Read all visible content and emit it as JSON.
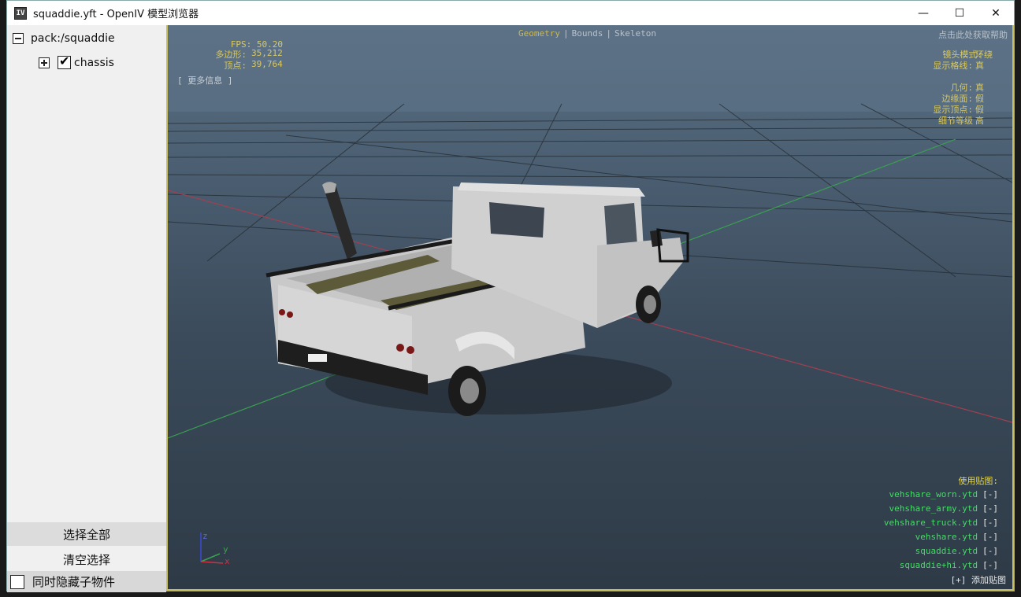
{
  "window": {
    "title": "squaddie.yft - OpenIV 模型浏览器",
    "app_icon_text": "IV",
    "min_glyph": "—",
    "max_glyph": "☐",
    "close_glyph": "✕"
  },
  "tree": {
    "root_label": "pack:/squaddie",
    "child_label": "chassis",
    "check_glyph": "✔"
  },
  "sidebar": {
    "select_all": "选择全部",
    "clear_selection": "清空选择",
    "hide_children": "同时隐藏子物件"
  },
  "hud": {
    "fps_label": "FPS:",
    "fps_value": "50.20",
    "polygons_label": "多边形:",
    "polygons_value": "35,212",
    "vertices_label": "顶点:",
    "vertices_value": "39,764",
    "more_info": "[ 更多信息 ]",
    "help": "点击此处获取帮助",
    "modes": [
      "Geometry",
      "Bounds",
      "Skeleton"
    ],
    "mode_sep": "|",
    "camera_mode_label": "镜头模式:",
    "camera_mode_value": "环绕",
    "show_grid_label": "显示格线:",
    "show_grid_value": "真",
    "geometry_label": "几何:",
    "geometry_value": "真",
    "edges_label": "边缘面:",
    "edges_value": "假",
    "show_vertices_label": "显示顶点:",
    "show_vertices_value": "假",
    "lod_label": "细节等级",
    "lod_value": "高"
  },
  "textures": {
    "header": "使用贴图:",
    "remove_glyph": "[-]",
    "items": [
      "vehshare_worn.ytd",
      "vehshare_army.ytd",
      "vehshare_truck.ytd",
      "vehshare.ytd",
      "squaddie.ytd",
      "squaddie+hi.ytd"
    ],
    "add": "[+] 添加贴图"
  },
  "axis": {
    "x": "x",
    "y": "y",
    "z": "z"
  },
  "colors": {
    "hud_yellow": "#d8c860",
    "texture_green": "#49d86a",
    "viewport_border": "#c8c060"
  }
}
